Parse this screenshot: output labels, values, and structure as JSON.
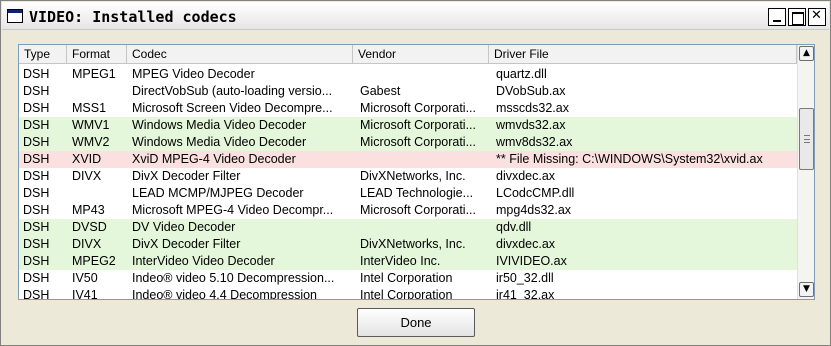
{
  "window": {
    "title": "VIDEO: Installed codecs"
  },
  "table": {
    "columns": [
      "Type",
      "Format",
      "Codec",
      "Vendor",
      "Driver File"
    ],
    "rows": [
      {
        "type": "DSH",
        "format": "MPEG1",
        "codec": "MPEG Video Decoder",
        "vendor": "",
        "driver": "quartz.dll",
        "status": "normal"
      },
      {
        "type": "DSH",
        "format": "",
        "codec": "DirectVobSub (auto-loading versio...",
        "vendor": "Gabest",
        "driver": "DVobSub.ax",
        "status": "normal"
      },
      {
        "type": "DSH",
        "format": "MSS1",
        "codec": "Microsoft Screen Video Decompre...",
        "vendor": "Microsoft Corporati...",
        "driver": "msscds32.ax",
        "status": "normal"
      },
      {
        "type": "DSH",
        "format": "WMV1",
        "codec": "Windows Media Video Decoder",
        "vendor": "Microsoft Corporati...",
        "driver": "wmvds32.ax",
        "status": "green"
      },
      {
        "type": "DSH",
        "format": "WMV2",
        "codec": "Windows Media Video Decoder",
        "vendor": "Microsoft Corporati...",
        "driver": "wmv8ds32.ax",
        "status": "green"
      },
      {
        "type": "DSH",
        "format": "XVID",
        "codec": "XviD MPEG-4 Video Decoder",
        "vendor": "",
        "driver": "** File Missing: C:\\WINDOWS\\System32\\xvid.ax",
        "status": "red"
      },
      {
        "type": "DSH",
        "format": "DIVX",
        "codec": "DivX Decoder Filter",
        "vendor": "DivXNetworks, Inc.",
        "driver": "divxdec.ax",
        "status": "normal"
      },
      {
        "type": "DSH",
        "format": "",
        "codec": "LEAD MCMP/MJPEG Decoder",
        "vendor": "LEAD Technologie...",
        "driver": "LCodcCMP.dll",
        "status": "normal"
      },
      {
        "type": "DSH",
        "format": "MP43",
        "codec": "Microsoft MPEG-4 Video Decompr...",
        "vendor": "Microsoft Corporati...",
        "driver": "mpg4ds32.ax",
        "status": "normal"
      },
      {
        "type": "DSH",
        "format": "DVSD",
        "codec": "DV Video Decoder",
        "vendor": "",
        "driver": "qdv.dll",
        "status": "green"
      },
      {
        "type": "DSH",
        "format": "DIVX",
        "codec": "DivX Decoder Filter",
        "vendor": "DivXNetworks, Inc.",
        "driver": "divxdec.ax",
        "status": "green"
      },
      {
        "type": "DSH",
        "format": "MPEG2",
        "codec": "InterVideo Video Decoder",
        "vendor": " InterVideo Inc.",
        "driver": "IVIVIDEO.ax",
        "status": "green"
      },
      {
        "type": "DSH",
        "format": "IV50",
        "codec": "Indeo® video 5.10 Decompression...",
        "vendor": "Intel Corporation",
        "driver": "ir50_32.dll",
        "status": "normal"
      },
      {
        "type": "DSH",
        "format": "IV41",
        "codec": "Indeo® video 4.4 Decompression",
        "vendor": "Intel Corporation",
        "driver": "ir41_32.ax",
        "status": "normal"
      }
    ]
  },
  "buttons": {
    "done": "Done"
  },
  "icons": {
    "window": "window-icon",
    "minimize": "minimize-icon",
    "maximize": "maximize-icon",
    "close": "close-icon",
    "scroll_up": "arrow-up-icon",
    "scroll_down": "arrow-down-icon"
  },
  "colors": {
    "row_ok": "#e4f7db",
    "row_missing": "#fbe0e0",
    "list_border": "#7f9db9"
  }
}
